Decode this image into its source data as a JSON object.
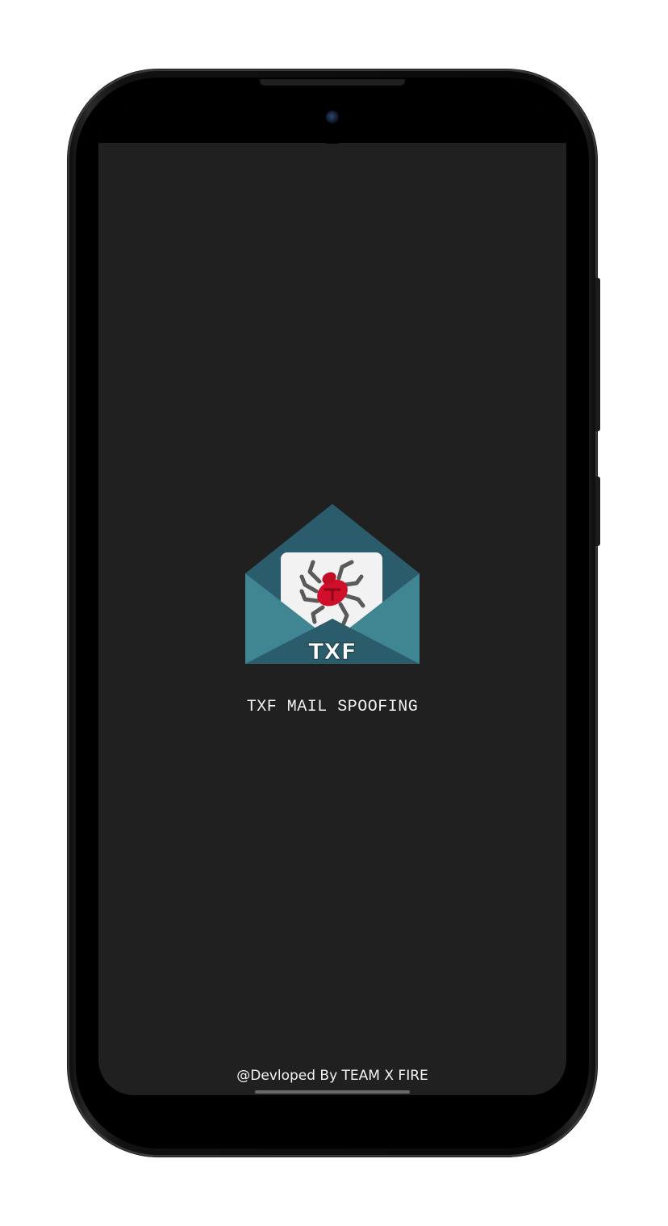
{
  "app": {
    "title": "TXF MAIL SPOOFING",
    "logo_text": "TXF",
    "credit": "@Devloped By TEAM X FIRE"
  },
  "icons": {
    "logo": "envelope-bug-logo",
    "camera": "front-camera-icon"
  },
  "colors": {
    "screen_background": "#202020",
    "envelope_dark": "#2b5c6b",
    "envelope_light": "#3f8592",
    "letter": "#f2f2f2",
    "bug": "#d0102a"
  }
}
